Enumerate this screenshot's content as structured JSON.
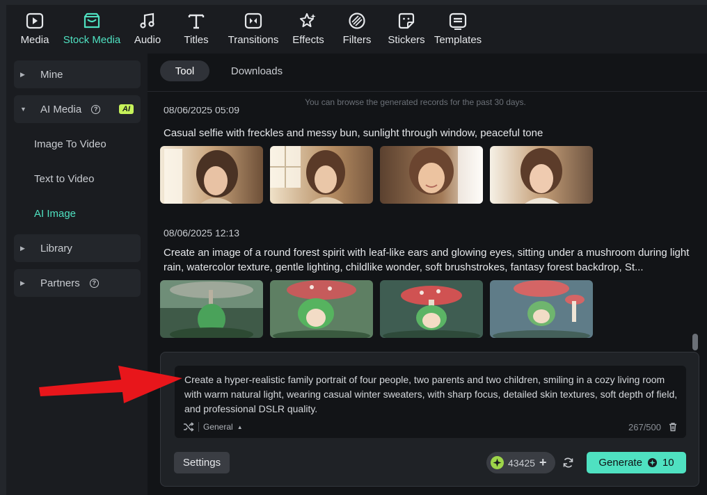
{
  "toolbar": {
    "items": [
      {
        "label": "Media",
        "icon": "media-icon"
      },
      {
        "label": "Stock Media",
        "icon": "stock-media-icon"
      },
      {
        "label": "Audio",
        "icon": "music-note-icon"
      },
      {
        "label": "Titles",
        "icon": "text-t-icon"
      },
      {
        "label": "Transitions",
        "icon": "transitions-icon"
      },
      {
        "label": "Effects",
        "icon": "effects-sparkle-icon"
      },
      {
        "label": "Filters",
        "icon": "filters-icon"
      },
      {
        "label": "Stickers",
        "icon": "stickers-icon"
      },
      {
        "label": "Templates",
        "icon": "templates-icon"
      }
    ],
    "active": "Stock Media",
    "accent": "#4fe1c1"
  },
  "sidebar": {
    "mine": "Mine",
    "ai_media": "AI Media",
    "ai_badge": "AI",
    "image_to_video": "Image To Video",
    "text_to_video": "Text to Video",
    "ai_image": "AI Image",
    "library": "Library",
    "partners": "Partners"
  },
  "tabs": {
    "tool": "Tool",
    "downloads": "Downloads"
  },
  "history": {
    "hint": "You can browse the generated records for the past 30 days.",
    "records": [
      {
        "date": "08/06/2025 05:09",
        "prompt": "Casual selfie with freckles and messy bun, sunlight through window, peaceful tone"
      },
      {
        "date": "08/06/2025 12:13",
        "prompt": "Create an image of a round forest spirit with leaf-like ears and glowing eyes, sitting under a mushroom during light rain, watercolor texture, gentle lighting, childlike wonder, soft brushstrokes, fantasy forest backdrop, St..."
      }
    ]
  },
  "prompt_panel": {
    "text": "Create a hyper-realistic family portrait of four people, two parents and two children, smiling in a cozy living room with warm natural light, wearing casual winter sweaters, with sharp focus, detailed skin textures, soft depth of field, and professional DSLR quality.",
    "style": "General",
    "counter": "267/500",
    "settings_label": "Settings",
    "credits": "43425",
    "generate_label": "Generate",
    "generate_cost": "10"
  }
}
